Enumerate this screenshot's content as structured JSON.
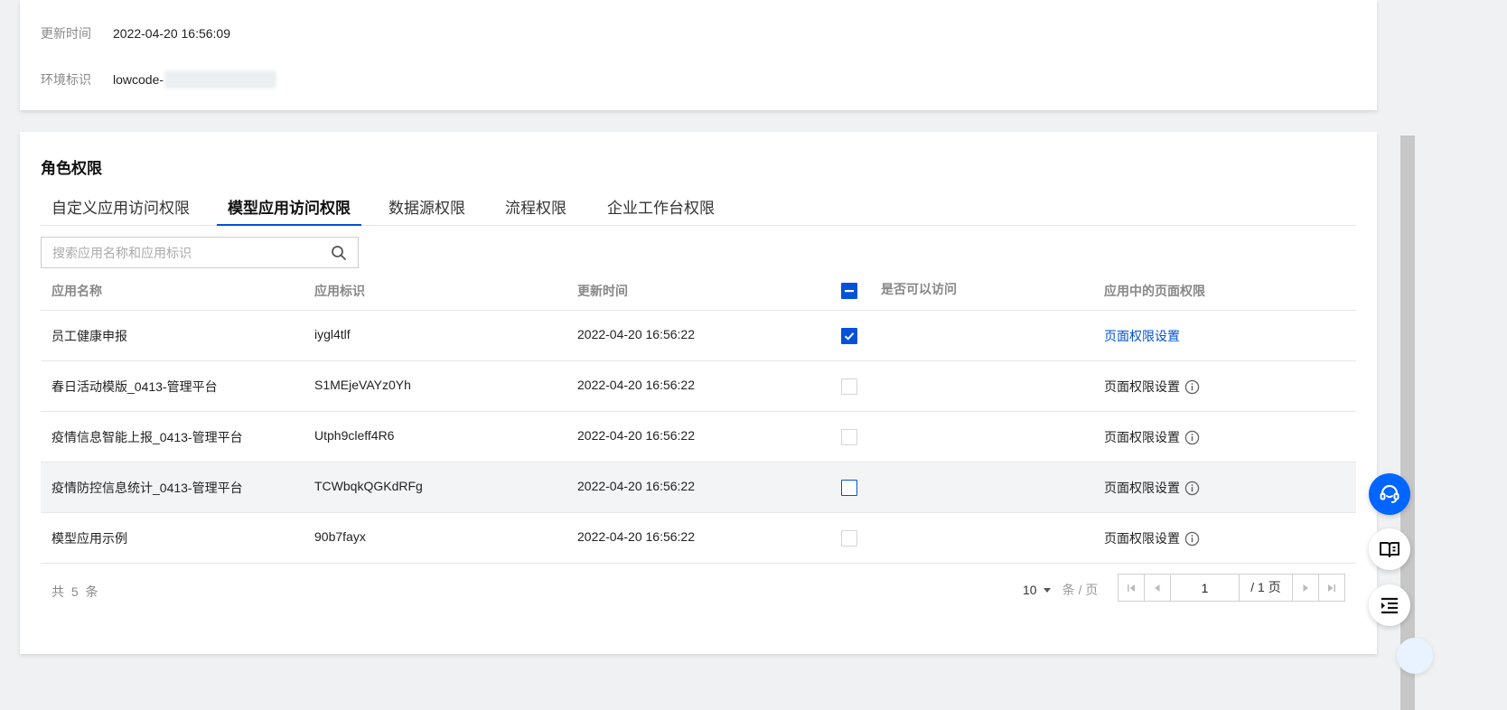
{
  "info": {
    "update_time_label": "更新时间",
    "update_time_value": "2022-04-20 16:56:09",
    "env_label": "环境标识",
    "env_value": "lowcode-"
  },
  "section": {
    "title": "角色权限"
  },
  "tabs": [
    {
      "label": "自定义应用访问权限",
      "active": false
    },
    {
      "label": "模型应用访问权限",
      "active": true
    },
    {
      "label": "数据源权限",
      "active": false
    },
    {
      "label": "流程权限",
      "active": false
    },
    {
      "label": "企业工作台权限",
      "active": false
    }
  ],
  "search": {
    "placeholder": "搜索应用名称和应用标识"
  },
  "table": {
    "headers": {
      "name": "应用名称",
      "id": "应用标识",
      "updated": "更新时间",
      "access": "是否可以访问",
      "page_perm": "应用中的页面权限"
    },
    "header_checkbox_state": "indeterminate",
    "rows": [
      {
        "name": "员工健康申报",
        "id": "iygl4tlf",
        "updated": "2022-04-20 16:56:22",
        "access": true,
        "perm_label": "页面权限设置",
        "perm_link": true
      },
      {
        "name": "春日活动模版_0413-管理平台",
        "id": "S1MEjeVAYz0Yh",
        "updated": "2022-04-20 16:56:22",
        "access": false,
        "perm_label": "页面权限设置",
        "perm_link": false
      },
      {
        "name": "疫情信息智能上报_0413-管理平台",
        "id": "Utph9cleff4R6",
        "updated": "2022-04-20 16:56:22",
        "access": false,
        "perm_label": "页面权限设置",
        "perm_link": false
      },
      {
        "name": "疫情防控信息统计_0413-管理平台",
        "id": "TCWbqkQGKdRFg",
        "updated": "2022-04-20 16:56:22",
        "access": false,
        "perm_label": "页面权限设置",
        "perm_link": false
      },
      {
        "name": "模型应用示例",
        "id": "90b7fayx",
        "updated": "2022-04-20 16:56:22",
        "access": false,
        "perm_label": "页面权限设置",
        "perm_link": false
      }
    ]
  },
  "footer": {
    "total": "共 5 条",
    "page_size": "10",
    "page_size_unit": "条 / 页",
    "current_page": "1",
    "total_pages": "/ 1 页"
  },
  "colors": {
    "accent": "#0052d9",
    "float_blue": "#0066ff"
  },
  "float_icons": [
    "customer-service-icon",
    "book-icon",
    "outline-menu-icon"
  ]
}
